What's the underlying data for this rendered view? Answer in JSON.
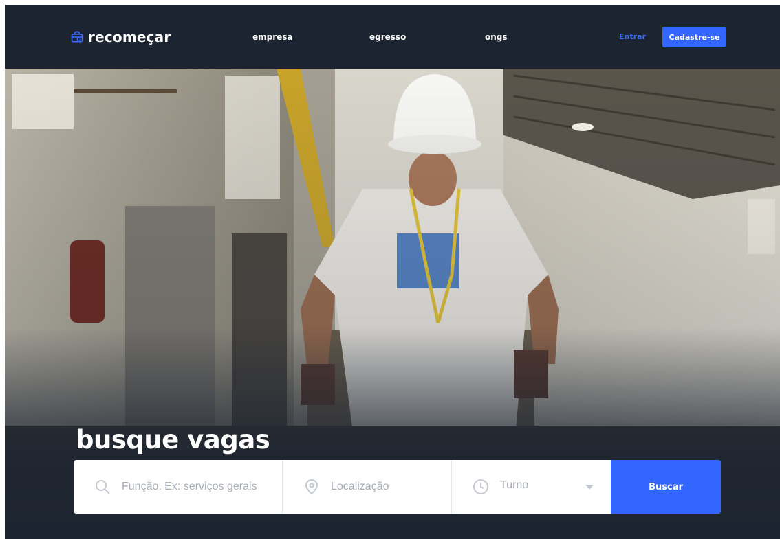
{
  "brand": {
    "name": "recomeçar",
    "icon": "briefcase-search-icon"
  },
  "nav": {
    "links": [
      "empresa",
      "egresso",
      "ongs"
    ],
    "login_label": "Entrar",
    "signup_label": "Cadastre-se"
  },
  "hero": {
    "headline": "busque vagas",
    "image": "photo of a worker in a white hard hat and t-shirt inside a warehouse"
  },
  "search": {
    "role_placeholder": "Função. Ex: serviços gerais",
    "location_placeholder": "Localização",
    "shift_label": "Turno",
    "submit_label": "Buscar"
  },
  "colors": {
    "background": "#1c2431",
    "accent": "#3366ff",
    "white": "#ffffff"
  }
}
